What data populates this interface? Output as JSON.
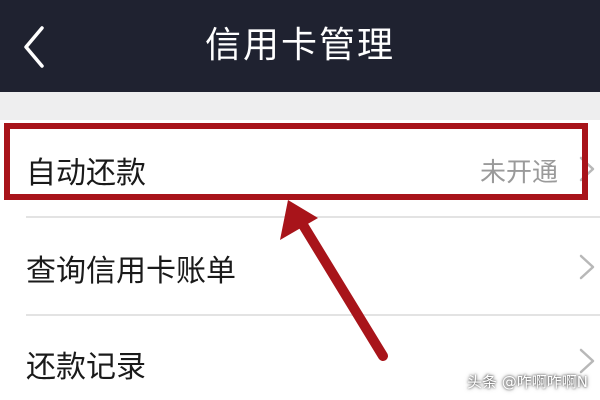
{
  "header": {
    "title": "信用卡管理",
    "back_icon": "chevron-left-icon",
    "background_color": "#1f2230"
  },
  "menu": {
    "items": [
      {
        "label": "自动还款",
        "status": "未开通"
      },
      {
        "label": "查询信用卡账单",
        "status": ""
      },
      {
        "label": "还款记录",
        "status": ""
      }
    ]
  },
  "annotation": {
    "color": "#a8141a",
    "target": "自动还款"
  },
  "watermark": "头条 @咋啊咋啊N"
}
